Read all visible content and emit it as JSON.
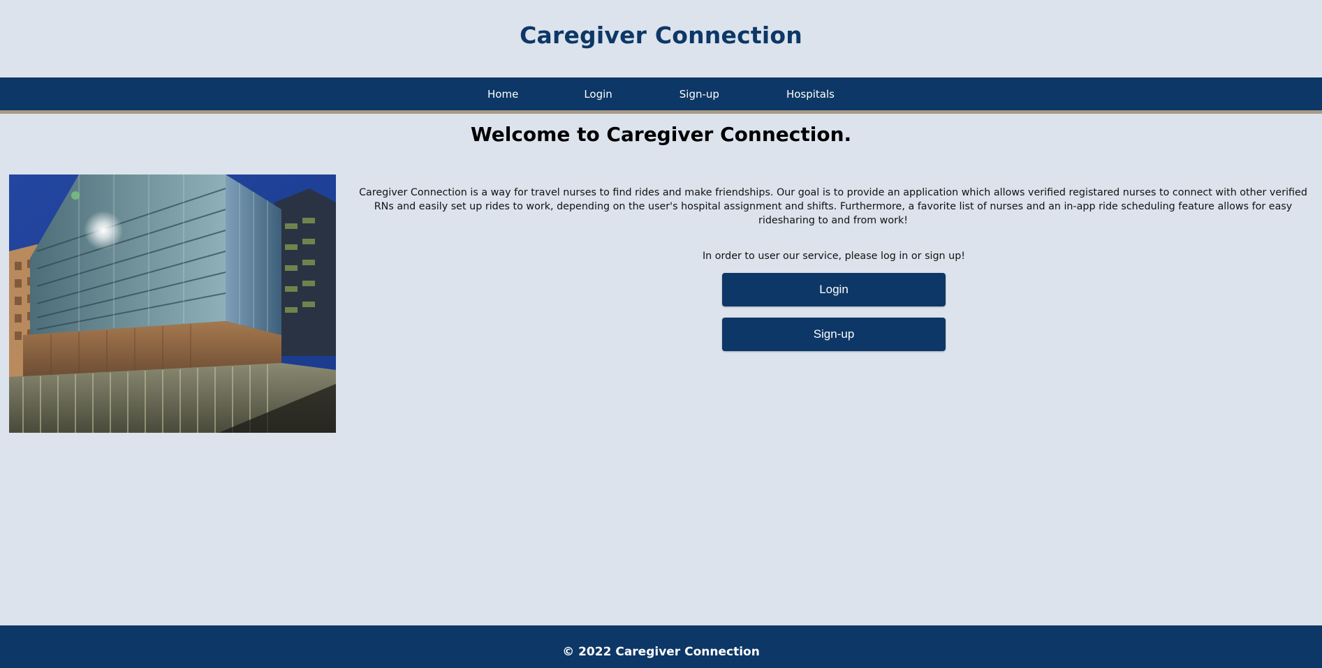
{
  "header": {
    "site_title": "Caregiver Connection"
  },
  "nav": {
    "items": [
      {
        "label": "Home"
      },
      {
        "label": "Login"
      },
      {
        "label": "Sign-up"
      },
      {
        "label": "Hospitals"
      }
    ]
  },
  "main": {
    "welcome_heading": "Welcome to Caregiver Connection.",
    "intro_text": "Caregiver Connection is a way for travel nurses to find rides and make friendships. Our goal is to provide an application which allows verified registared nurses to connect with other verified RNs and easily set up rides to work, depending on the user's hospital assignment and shifts. Furthermore, a favorite list of nurses and an in-app ride scheduling feature allows for easy ridesharing to and from work!",
    "cta_prompt": "In order to user our service, please log in or sign up!",
    "login_button": "Login",
    "signup_button": "Sign-up"
  },
  "footer": {
    "text": "© 2022 Caregiver Connection"
  },
  "colors": {
    "page_background": "#dce3ec",
    "brand_navy": "#0d3766",
    "nav_accent_border": "#a89a84"
  }
}
